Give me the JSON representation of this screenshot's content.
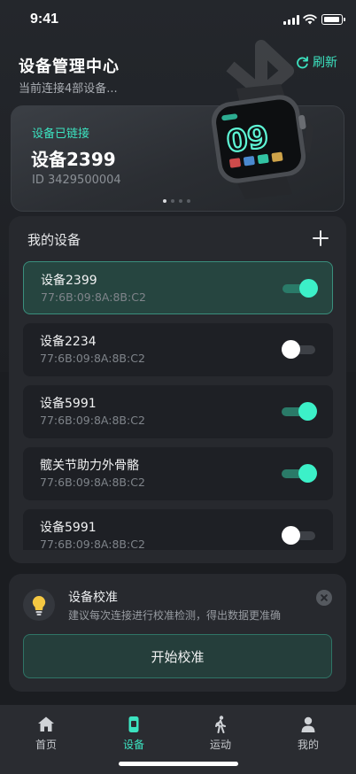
{
  "status_bar": {
    "time": "9:41"
  },
  "header": {
    "title": "设备管理中心",
    "subtitle": "当前连接4部设备...",
    "refresh_label": "刷新"
  },
  "current_device": {
    "status": "设备已链接",
    "name": "设备2399",
    "id_text": "ID 3429500004",
    "watch_display": "09",
    "carousel_pages": 4,
    "carousel_active": 0
  },
  "devices_panel": {
    "title": "我的设备",
    "items": [
      {
        "name": "设备2399",
        "mac": "77:6B:09:8A:8B:C2",
        "enabled": true,
        "selected": true
      },
      {
        "name": "设备2234",
        "mac": "77:6B:09:8A:8B:C2",
        "enabled": false,
        "selected": false
      },
      {
        "name": "设备5991",
        "mac": "77:6B:09:8A:8B:C2",
        "enabled": true,
        "selected": false
      },
      {
        "name": "髋关节助力外骨骼",
        "mac": "77:6B:09:8A:8B:C2",
        "enabled": true,
        "selected": false
      },
      {
        "name": "设备5991",
        "mac": "77:6B:09:8A:8B:C2",
        "enabled": false,
        "selected": false
      }
    ]
  },
  "calibration": {
    "title": "设备校准",
    "description": "建议每次连接进行校准检测，得出数据更准确",
    "button_label": "开始校准"
  },
  "tab_bar": {
    "tabs": [
      {
        "label": "首页",
        "icon": "home-icon"
      },
      {
        "label": "设备",
        "icon": "device-icon"
      },
      {
        "label": "运动",
        "icon": "walking-icon"
      },
      {
        "label": "我的",
        "icon": "profile-icon"
      }
    ],
    "active_index": 1
  },
  "colors": {
    "accent": "#3ce3c0",
    "background": "#1b1d21",
    "panel": "#27292e"
  }
}
